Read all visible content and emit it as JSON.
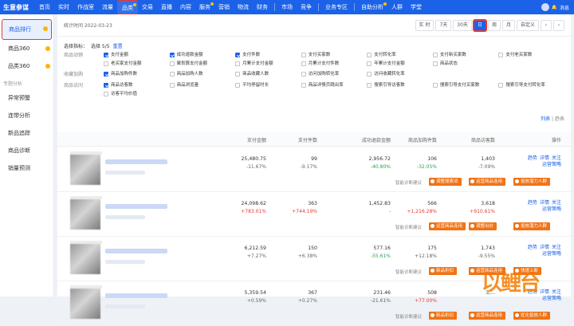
{
  "nav": {
    "brand": "生意参谋",
    "items": [
      {
        "label": "首页",
        "active": false,
        "dot": false
      },
      {
        "label": "实时",
        "active": false,
        "dot": false
      },
      {
        "label": "作战室",
        "active": false,
        "dot": false
      },
      {
        "label": "流量",
        "active": false,
        "dot": false
      },
      {
        "label": "品类",
        "active": true,
        "dot": true
      },
      {
        "label": "交易",
        "active": false,
        "dot": false
      },
      {
        "label": "直播",
        "active": false,
        "dot": false
      },
      {
        "label": "内容",
        "active": false,
        "dot": false
      },
      {
        "label": "服务",
        "active": false,
        "dot": true
      },
      {
        "label": "营销",
        "active": false,
        "dot": false
      },
      {
        "label": "物流",
        "active": false,
        "dot": false
      },
      {
        "label": "财务",
        "active": false,
        "dot": false
      }
    ],
    "items2": [
      {
        "label": "市场",
        "dot": false
      },
      {
        "label": "竞争",
        "dot": false
      }
    ],
    "items3": [
      {
        "label": "业务专区",
        "dot": false
      }
    ],
    "items4": [
      {
        "label": "自助分析",
        "dot": true
      },
      {
        "label": "人群",
        "dot": false
      },
      {
        "label": "学堂",
        "dot": false
      }
    ],
    "message": "消息"
  },
  "sidebar": {
    "active": "商品排行",
    "items1": [
      {
        "label": "商品360",
        "dot": "yellow"
      },
      {
        "label": "品类360",
        "dot": "yellow"
      }
    ],
    "group": "专题分析",
    "items2": [
      "异常预警",
      "连带分析",
      "新品追踪",
      "商品诊断",
      "销量预测"
    ]
  },
  "datebar": {
    "label": "统计时间 2022-03-23",
    "buttons": [
      "实 时",
      "7天",
      "30天",
      "日",
      "周",
      "月",
      "自定义"
    ],
    "selected": "日"
  },
  "indicators": {
    "label": "选择指标：",
    "count": "选择 5/5",
    "reset": "重置",
    "groups": [
      {
        "name": "商品动销",
        "items": [
          {
            "t": "支付金额",
            "on": true
          },
          {
            "t": "成功退款金额",
            "on": true
          },
          {
            "t": "支付件数",
            "on": true
          },
          {
            "t": "支付买家数",
            "on": false
          },
          {
            "t": "支付转化率",
            "on": false
          },
          {
            "t": "支付新买家数",
            "on": false
          },
          {
            "t": "支付老买家数",
            "on": false
          },
          {
            "t": "老买家支付金额",
            "on": false
          },
          {
            "t": "聚划算支付金额",
            "on": false
          },
          {
            "t": "月累计支付金额",
            "on": false
          },
          {
            "t": "月累计支付件数",
            "on": false
          },
          {
            "t": "年累计支付金额",
            "on": false
          },
          {
            "t": "商品状态",
            "on": false
          },
          {
            "t": "",
            "on": null
          }
        ]
      },
      {
        "name": "收藏加购",
        "items": [
          {
            "t": "商品加购件数",
            "on": true
          },
          {
            "t": "商品加购人数",
            "on": false
          },
          {
            "t": "商品收藏人数",
            "on": false
          },
          {
            "t": "访问加购转化率",
            "on": false
          },
          {
            "t": "访问收藏转化率",
            "on": false
          }
        ]
      },
      {
        "name": "商品访问",
        "items": [
          {
            "t": "商品访客数",
            "on": true
          },
          {
            "t": "商品浏览量",
            "on": false
          },
          {
            "t": "平均停留时长",
            "on": false
          },
          {
            "t": "商品详情页跳出率",
            "on": false
          },
          {
            "t": "搜索引导访客数",
            "on": false
          },
          {
            "t": "搜索引导支付买家数",
            "on": false
          },
          {
            "t": "搜索引导支付转化率",
            "on": false
          },
          {
            "t": "访客平均价值",
            "on": false
          }
        ]
      }
    ]
  },
  "view_switch": {
    "list": "列表",
    "chart": "趋表"
  },
  "table": {
    "headers": [
      "支付金额",
      "支付件数",
      "成功退款金额",
      "商品加购件数",
      "商品访客数",
      "操作"
    ],
    "diag_label": "智能诊断建议",
    "rows": [
      {
        "vals": [
          "25,480.75",
          "99",
          "2,956.72",
          "106",
          "1,403"
        ],
        "chg": [
          [
            "-11.67%",
            "n"
          ],
          [
            "-9.17%",
            "n"
          ],
          [
            "-40.80%",
            "g"
          ],
          [
            "-32.05%",
            "g"
          ],
          [
            "-7.09%",
            "n"
          ]
        ],
        "tags": [
          "调整搜索词",
          "运营商品连用",
          "投放潜力人群"
        ]
      },
      {
        "vals": [
          "24,098.62",
          "363",
          "1,452.83",
          "566",
          "3,618"
        ],
        "chg": [
          [
            "+783.01%",
            "r"
          ],
          [
            "+744.19%",
            "r"
          ],
          [
            "-",
            "n"
          ],
          [
            "+1,216.28%",
            "r"
          ],
          [
            "+910.61%",
            "r"
          ]
        ],
        "tags": [
          "运营商品连用",
          "调整出价",
          "投放潜力人群"
        ]
      },
      {
        "vals": [
          "6,212.59",
          "150",
          "577.16",
          "175",
          "1,743"
        ],
        "chg": [
          [
            "+7.27%",
            "n"
          ],
          [
            "+6.38%",
            "n"
          ],
          [
            "-55.61%",
            "g"
          ],
          [
            "+12.18%",
            "n"
          ],
          [
            "-9.55%",
            "n"
          ]
        ],
        "tags": [
          "新品折扣",
          "运营商品连用",
          "快速上新"
        ]
      },
      {
        "vals": [
          "5,359.54",
          "367",
          "231.46",
          "508",
          "3,..."
        ],
        "chg": [
          [
            "+0.59%",
            "n"
          ],
          [
            "+0.27%",
            "n"
          ],
          [
            "-21.61%",
            "n"
          ],
          [
            "+77.00%",
            "r"
          ],
          [
            "",
            ""
          ]
        ],
        "tags": [
          "新品折扣",
          "运营商品连用",
          "优化投放人群"
        ]
      }
    ],
    "ops": [
      "趋势",
      "详情",
      "关注",
      "运营策略"
    ]
  },
  "watermark": {
    "a": "以",
    "b": "鲤",
    "c": "台"
  }
}
